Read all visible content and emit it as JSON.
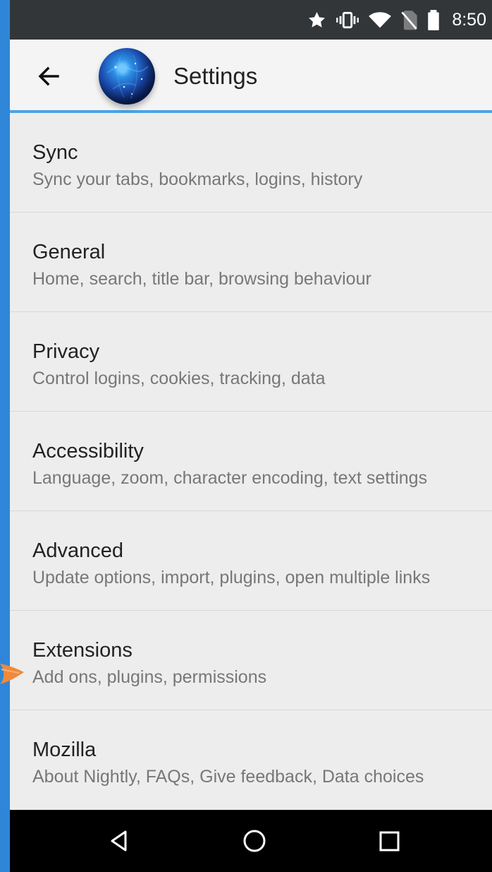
{
  "status_bar": {
    "time": "8:50",
    "icons": [
      "star-icon",
      "vibrate-icon",
      "wifi-icon",
      "no-sim-icon",
      "battery-icon"
    ]
  },
  "toolbar": {
    "title": "Settings",
    "back_icon": "back-arrow-icon",
    "logo_icon": "nightly-globe-icon"
  },
  "settings": {
    "items": [
      {
        "title": "Sync",
        "summary": "Sync your tabs, bookmarks, logins, history"
      },
      {
        "title": "General",
        "summary": "Home, search, title bar, browsing behaviour"
      },
      {
        "title": "Privacy",
        "summary": "Control logins, cookies, tracking, data"
      },
      {
        "title": "Accessibility",
        "summary": "Language, zoom, character encoding, text settings"
      },
      {
        "title": "Advanced",
        "summary": "Update options, import, plugins, open multiple links"
      },
      {
        "title": "Extensions",
        "summary": "Add ons, plugins, permissions"
      },
      {
        "title": "Mozilla",
        "summary": "About Nightly, FAQs, Give feedback, Data choices"
      }
    ]
  },
  "navigation_bar": {
    "icons": [
      "nav-back-icon",
      "home-icon",
      "overview-icon"
    ]
  },
  "colors": {
    "outer_background": "#2f86d9",
    "status_bar": "#333638",
    "toolbar": "#f4f4f4",
    "toolbar_divider": "#4aa3e3",
    "list_background": "#ededed",
    "list_divider": "#d8d8d8",
    "title_text": "#222222",
    "summary_text": "#777777",
    "navigation_bar": "#000000",
    "annotation_mark": "#f08a3a"
  }
}
